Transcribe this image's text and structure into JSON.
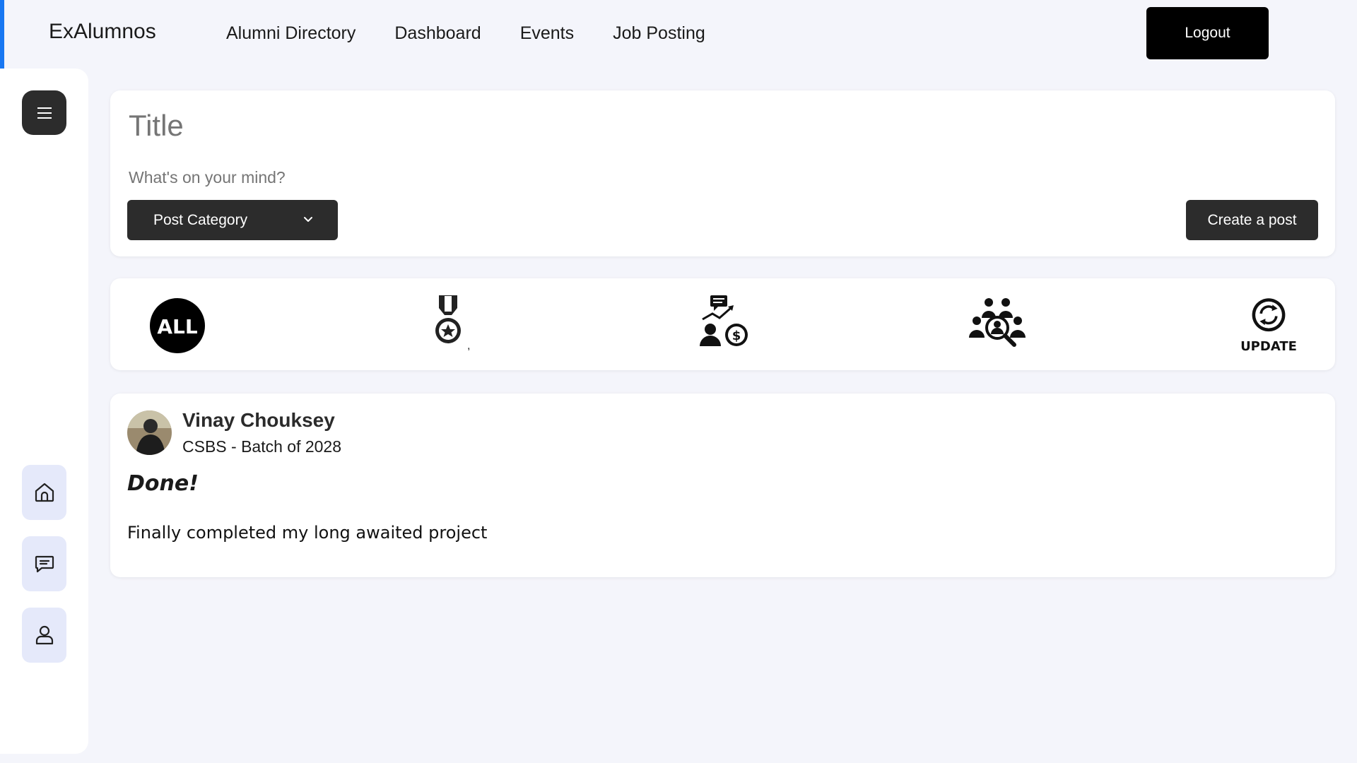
{
  "brand": "ExAlumnos",
  "nav": {
    "links": [
      "Alumni Directory",
      "Dashboard",
      "Events",
      "Job Posting"
    ],
    "logout_label": "Logout"
  },
  "sidebar": {
    "menu_icon": "hamburger-icon",
    "items": [
      {
        "icon": "home-icon"
      },
      {
        "icon": "chat-icon"
      },
      {
        "icon": "profile-icon"
      }
    ]
  },
  "composer": {
    "title_placeholder": "Title",
    "body_placeholder": "What's on your mind?",
    "category_label": "Post Category",
    "create_label": "Create a post"
  },
  "filters": {
    "all_label": "ALL",
    "medal_suffix": ",",
    "update_label": "UPDATE",
    "icons": [
      "all-icon",
      "achievement-medal-icon",
      "investment-icon",
      "recruitment-icon",
      "update-icon"
    ]
  },
  "post": {
    "author": "Vinay Chouksey",
    "batch": "CSBS - Batch of 2028",
    "title": "Done!",
    "body": "Finally completed my long awaited project"
  },
  "colors": {
    "accent": "#1877f2",
    "background": "#f4f5fb",
    "dark_button": "#2c2c2c",
    "sidebar_button": "#e5e9fa"
  }
}
